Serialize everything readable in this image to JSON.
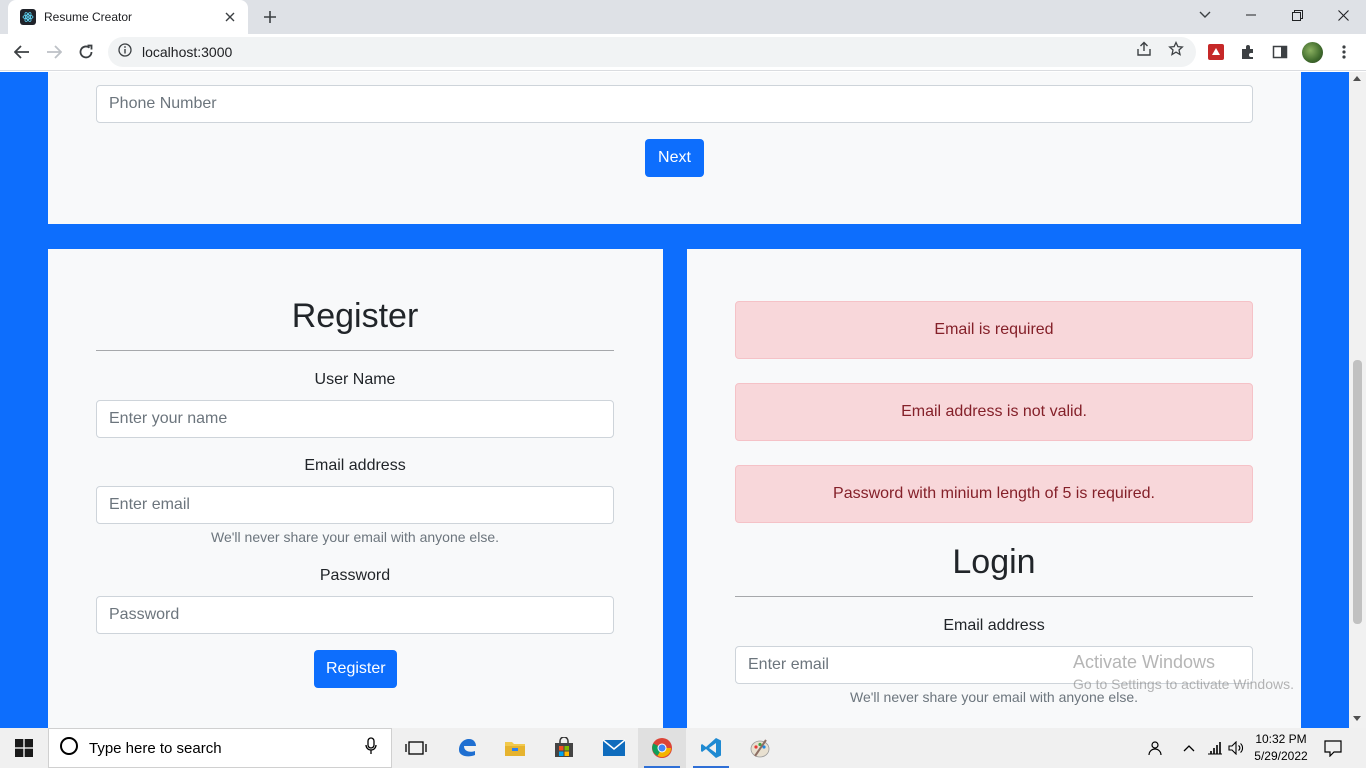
{
  "browser": {
    "tab_title": "Resume Creator",
    "url": "localhost:3000"
  },
  "page": {
    "personal": {
      "phone_placeholder": "Phone Number",
      "next_label": "Next"
    },
    "register": {
      "title": "Register",
      "username_label": "User Name",
      "username_placeholder": "Enter your name",
      "email_label": "Email address",
      "email_placeholder": "Enter email",
      "email_help": "We'll never share your email with anyone else.",
      "password_label": "Password",
      "password_placeholder": "Password",
      "submit_label": "Register"
    },
    "login": {
      "alerts": [
        "Email is required",
        "Email address is not valid.",
        "Password with minium length of 5 is required."
      ],
      "title": "Login",
      "email_label": "Email address",
      "email_placeholder": "Enter email",
      "email_help": "We'll never share your email with anyone else."
    }
  },
  "watermark": {
    "line1": "Activate Windows",
    "line2": "Go to Settings to activate Windows."
  },
  "taskbar": {
    "search_placeholder": "Type here to search",
    "time": "10:32 PM",
    "date": "5/29/2022"
  },
  "colors": {
    "primary": "#0d6efd",
    "card_bg": "#f8f9fa",
    "alert_bg": "#f8d7da",
    "alert_text": "#842029"
  }
}
